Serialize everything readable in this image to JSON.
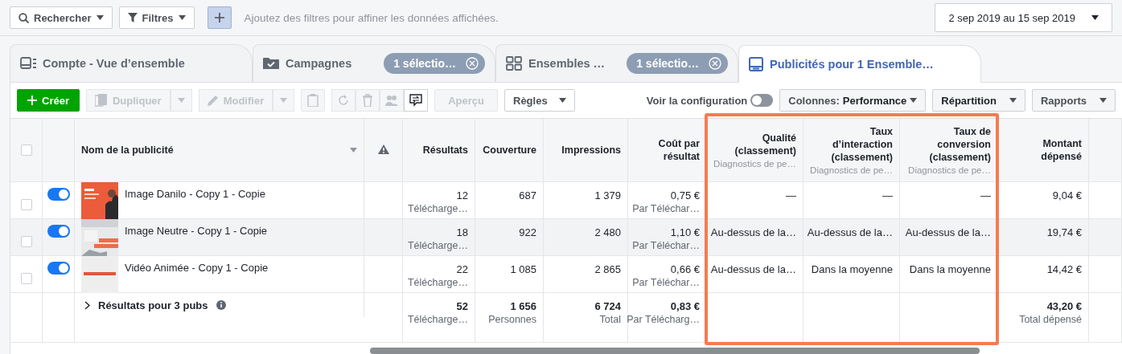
{
  "filter_bar": {
    "search": "Rechercher",
    "filters": "Filtres",
    "hint": "Ajoutez des filtres pour affiner les données affichées.",
    "date_range": "2 sep 2019 au 15 sep 2019"
  },
  "tabs": [
    {
      "label": "Compte - Vue d’ensemble",
      "selected": false
    },
    {
      "label": "Campagnes",
      "badge": "1 sélectio…",
      "selected": false
    },
    {
      "label": "Ensembles …",
      "badge": "1 sélectio…",
      "selected": false
    },
    {
      "label": "Publicités pour 1 Ensemble…",
      "selected": true
    }
  ],
  "toolbar": {
    "create": "Créer",
    "duplicate": {
      "label": "Dupliquer",
      "disabled": true
    },
    "modify": {
      "label": "Modifier",
      "disabled": true
    },
    "preview": {
      "label": "Aperçu",
      "disabled": true
    },
    "rules": "Règles",
    "config": {
      "label": "Voir la configuration",
      "on": false
    },
    "columns_label": "Colonnes:",
    "columns_value": "Performance",
    "breakdown": "Répartition",
    "reports": "Rapports"
  },
  "table": {
    "all_selected": false,
    "columns": [
      {
        "label": "Nom de la publicité"
      },
      {
        "label": "Résultats"
      },
      {
        "label": "Couverture"
      },
      {
        "label": "Impressions"
      },
      {
        "label": "Coût par résultat"
      },
      {
        "label": "Qualité (classement)",
        "sublabel": "Diagnostics de pe…"
      },
      {
        "label": "Taux d’interaction (classement)",
        "sublabel": "Diagnostics de pe…"
      },
      {
        "label": "Taux de conversion (classement)",
        "sublabel": "Diagnostics de pe…"
      },
      {
        "label": "Montant dépensé"
      }
    ],
    "rows": [
      {
        "selected": false,
        "active": true,
        "hovered": false,
        "name": "Image Danilo - Copy 1 - Copie",
        "results": "12",
        "results_sub": "Télécharge…",
        "reach": "687",
        "impressions": "1 379",
        "cost": "0,75 €",
        "cost_sub": "Par Téléchar…",
        "quality": "—",
        "engagement": "—",
        "conversion": "—",
        "spent": "9,04 €"
      },
      {
        "selected": false,
        "active": true,
        "hovered": true,
        "name": "Image Neutre - Copy 1 - Copie",
        "results": "18",
        "results_sub": "Télécharge…",
        "reach": "922",
        "impressions": "2 480",
        "cost": "1,10 €",
        "cost_sub": "Par Téléchar…",
        "quality": "Au-dessus de la…",
        "engagement": "Au-dessus de la…",
        "conversion": "Au-dessus de la…",
        "spent": "19,74 €"
      },
      {
        "selected": false,
        "active": true,
        "hovered": false,
        "name": "Vidéo Animée - Copy 1 - Copie",
        "results": "22",
        "results_sub": "Télécharge…",
        "reach": "1 085",
        "impressions": "2 865",
        "cost": "0,66 €",
        "cost_sub": "Par Téléchar…",
        "quality": "Au-dessus de la…",
        "engagement": "Dans la moyenne",
        "conversion": "Dans la moyenne",
        "spent": "14,42 €"
      }
    ],
    "total": {
      "label": "Résultats pour 3 pubs",
      "results": "52",
      "results_sub": "Télécharge…",
      "reach": "1 656",
      "reach_sub": "Personnes",
      "impressions": "6 724",
      "impressions_sub": "Total",
      "cost": "0,83 €",
      "cost_sub": "Par Télécharg…",
      "spent": "43,20 €",
      "spent_sub": "Total dépensé"
    }
  }
}
